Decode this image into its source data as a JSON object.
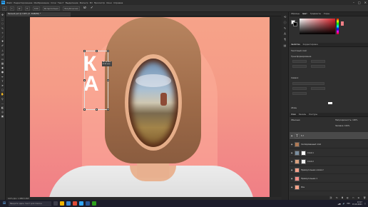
{
  "menubar": {
    "logo": "Ps",
    "items": [
      "Файл",
      "Редактирование",
      "Изображение",
      "Слои",
      "Текст",
      "Выделение",
      "Фильтр",
      "3D",
      "Просмотр",
      "Окно",
      "Справка"
    ],
    "min": "–",
    "max": "□",
    "close": "✕"
  },
  "options": {
    "field1": "X:",
    "field2": "Y:",
    "field3": "W:",
    "field4": "H:",
    "field5": "0.00",
    "interp": "Интерполяция:",
    "interp_value": "Бикубическая",
    "cancel": "⊘",
    "commit": "✓"
  },
  "doc": {
    "tab": "Белые2.psd @ 100% (К, RGB/8#) *",
    "status": "100%   Док: 1,98M/3,26M"
  },
  "canvas": {
    "letters": [
      "К",
      "А"
    ],
    "tooltip": "Ш: 34 пикс\nВ: 83 пикс"
  },
  "panels": {
    "color_tabs": [
      "Образцы",
      "Цвет",
      "Градиенты",
      "Узоры"
    ],
    "props_tabs": [
      "Свойства",
      "Корректировка"
    ],
    "text_layer": "Текстовый слой",
    "transform": "Трансформирование",
    "char": "Символ",
    "paragraph": "Абзац",
    "layers_tabs": [
      "Слои",
      "Каналы",
      "Контуры"
    ],
    "blend": "Обычные",
    "opacity": "Непрозрачность: 100%",
    "fill": "Заливка: 100%",
    "layers": [
      {
        "name": "К А",
        "type": "text"
      },
      {
        "name": "Скопированный слой",
        "type": "img"
      },
      {
        "name": "Слой 1",
        "type": "mask"
      },
      {
        "name": "Слой 2",
        "type": "mask"
      },
      {
        "name": "Прямоугольник копия 2",
        "type": "rect"
      },
      {
        "name": "Прямоугольник 1",
        "type": "rect"
      },
      {
        "name": "Фон",
        "type": "bg"
      }
    ]
  },
  "taskbar": {
    "search": "Введите здесь текст для поиска",
    "time": "13:17",
    "date": "15.10.2021",
    "lang": "РУС"
  },
  "colors": {
    "accent": "#31a8ff",
    "canvas_top": "#f6a389",
    "canvas_bottom": "#f07f86"
  }
}
